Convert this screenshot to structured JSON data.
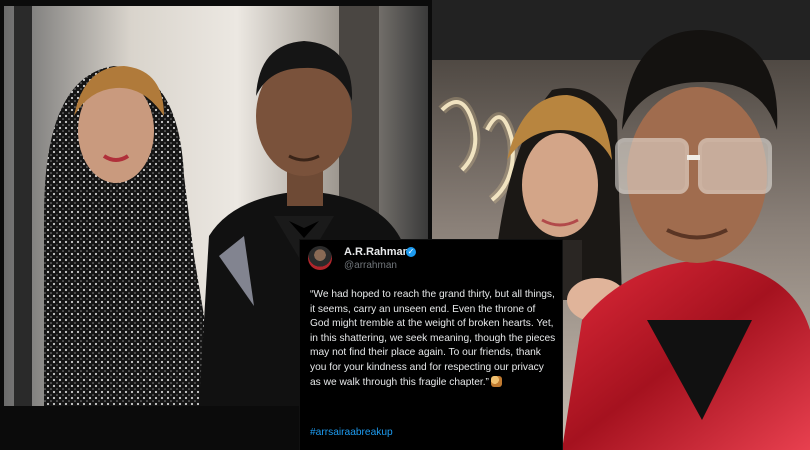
{
  "tweet": {
    "name": "A.R.Rahman",
    "handle": "@arrahman",
    "text": "“We had hoped to reach the grand thirty, but all things, it seems, carry an unseen end. Even the throne of God might tremble at the weight of broken hearts. Yet, in this shattering, we seek meaning, though the pieces may not find their place again. To our friends, thank you for your kindness and for respecting our privacy as we walk through this fragile chapter.”",
    "hashtag": "#arrsairaabreakup",
    "verified_icon": "verified-badge-icon",
    "colors": {
      "background": "#000000",
      "text": "#e7e9ea",
      "link": "#1d9bf0",
      "verified": "#1d9bf0"
    }
  },
  "photos": {
    "left": {
      "description_icon": "couple-photo-left"
    },
    "right": {
      "description_icon": "couple-selfie-right"
    }
  }
}
